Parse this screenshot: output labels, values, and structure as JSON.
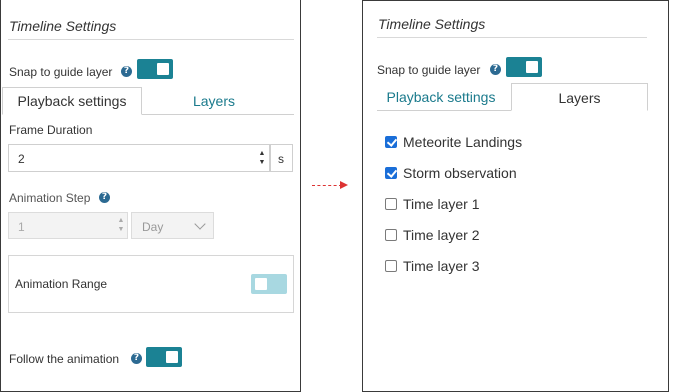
{
  "colors": {
    "toggle_on": "#1b8294",
    "toggle_off": "#a8d8e1",
    "link": "#1a7a8c",
    "checkbox": "#1a6ed8",
    "arrow": "#dd3333"
  },
  "left_panel": {
    "title": "Timeline Settings",
    "snap_label": "Snap to guide layer",
    "snap_toggle_on": true,
    "tabs": [
      {
        "label": "Playback settings",
        "active": true
      },
      {
        "label": "Layers",
        "active": false
      }
    ],
    "frame_duration": {
      "label": "Frame Duration",
      "value": "2",
      "unit": "s"
    },
    "animation_step": {
      "label": "Animation Step",
      "value": "1",
      "unit_selected": "Day",
      "disabled": true
    },
    "animation_range": {
      "label": "Animation Range",
      "toggle_on": false
    },
    "follow": {
      "label": "Follow the animation",
      "toggle_on": true
    }
  },
  "right_panel": {
    "title": "Timeline Settings",
    "snap_label": "Snap to guide layer",
    "snap_toggle_on": true,
    "tabs": [
      {
        "label": "Playback settings",
        "active": false
      },
      {
        "label": "Layers",
        "active": true
      }
    ],
    "layers": [
      {
        "label": "Meteorite Landings",
        "checked": true
      },
      {
        "label": "Storm observation",
        "checked": true
      },
      {
        "label": "Time layer 1",
        "checked": false
      },
      {
        "label": "Time layer 2",
        "checked": false
      },
      {
        "label": "Time layer 3",
        "checked": false
      }
    ]
  },
  "icons": {
    "help": "question-circle-icon",
    "spinner_up": "▲",
    "spinner_down": "▼",
    "arrow": "dashed-arrow-right"
  }
}
